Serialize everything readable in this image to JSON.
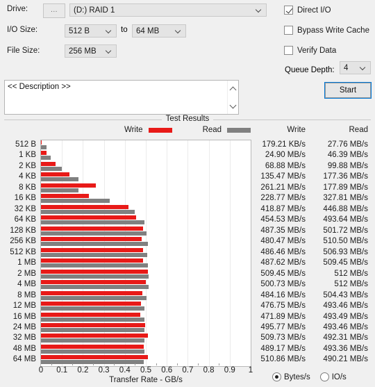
{
  "settings": {
    "drive_label": "Drive:",
    "browse_label": "...",
    "drive_value": "(D:) RAID 1",
    "io_size_label": "I/O Size:",
    "io_size_from": "512 B",
    "io_size_to_label": "to",
    "io_size_to": "64 MB",
    "file_size_label": "File Size:",
    "file_size_value": "256 MB",
    "direct_io_label": "Direct I/O",
    "direct_io_checked": true,
    "bypass_cache_label": "Bypass Write Cache",
    "bypass_cache_checked": false,
    "verify_data_label": "Verify Data",
    "verify_data_checked": false,
    "queue_depth_label": "Queue Depth:",
    "queue_depth_value": "4"
  },
  "description": {
    "text": "<< Description >>"
  },
  "start_button": {
    "label": "Start"
  },
  "results": {
    "title": "Test Results",
    "legend_write": "Write",
    "legend_read": "Read",
    "col_write": "Write",
    "col_read": "Read",
    "write_color": "#e81a18",
    "read_color": "#808080"
  },
  "units": {
    "bytes_label": "Bytes/s",
    "io_label": "IO/s",
    "selected": "Bytes/s"
  },
  "chart_data": {
    "type": "bar",
    "title": "Test Results",
    "xlabel": "Transfer Rate - GB/s",
    "ylabel": "",
    "xlim": [
      0,
      1
    ],
    "xticks": [
      "0",
      "0.1",
      "0.2",
      "0.3",
      "0.4",
      "0.5",
      "0.6",
      "0.7",
      "0.8",
      "0.9",
      "1"
    ],
    "grid": true,
    "legend_position": "top",
    "orientation": "horizontal",
    "categories": [
      "512 B",
      "1 KB",
      "2 KB",
      "4 KB",
      "8 KB",
      "16 KB",
      "32 KB",
      "64 KB",
      "128 KB",
      "256 KB",
      "512 KB",
      "1 MB",
      "2 MB",
      "4 MB",
      "8 MB",
      "12 MB",
      "16 MB",
      "24 MB",
      "32 MB",
      "48 MB",
      "64 MB"
    ],
    "series": [
      {
        "name": "Write",
        "color": "#e81a18",
        "unit": "GB/s",
        "values": [
          0.000179,
          0.0249,
          0.06888,
          0.13547,
          0.26121,
          0.22877,
          0.41887,
          0.45453,
          0.48735,
          0.48047,
          0.48646,
          0.48762,
          0.50945,
          0.50073,
          0.48416,
          0.47675,
          0.47189,
          0.49577,
          0.50973,
          0.48917,
          0.51086
        ],
        "labels": [
          "179.21 KB/s",
          "24.90 MB/s",
          "68.88 MB/s",
          "135.47 MB/s",
          "261.21 MB/s",
          "228.77 MB/s",
          "418.87 MB/s",
          "454.53 MB/s",
          "487.35 MB/s",
          "480.47 MB/s",
          "486.46 MB/s",
          "487.62 MB/s",
          "509.45 MB/s",
          "500.73 MB/s",
          "484.16 MB/s",
          "476.75 MB/s",
          "471.89 MB/s",
          "495.77 MB/s",
          "509.73 MB/s",
          "489.17 MB/s",
          "510.86 MB/s"
        ]
      },
      {
        "name": "Read",
        "color": "#808080",
        "unit": "GB/s",
        "values": [
          0.02776,
          0.04639,
          0.09988,
          0.17736,
          0.17789,
          0.32781,
          0.44688,
          0.49364,
          0.50172,
          0.5105,
          0.50693,
          0.50945,
          0.512,
          0.512,
          0.50443,
          0.49346,
          0.49349,
          0.49346,
          0.49231,
          0.49336,
          0.49021
        ],
        "labels": [
          "27.76 MB/s",
          "46.39 MB/s",
          "99.88 MB/s",
          "177.36 MB/s",
          "177.89 MB/s",
          "327.81 MB/s",
          "446.88 MB/s",
          "493.64 MB/s",
          "501.72 MB/s",
          "510.50 MB/s",
          "506.93 MB/s",
          "509.45 MB/s",
          "512 MB/s",
          "512 MB/s",
          "504.43 MB/s",
          "493.46 MB/s",
          "493.49 MB/s",
          "493.46 MB/s",
          "492.31 MB/s",
          "493.36 MB/s",
          "490.21 MB/s"
        ]
      }
    ]
  }
}
